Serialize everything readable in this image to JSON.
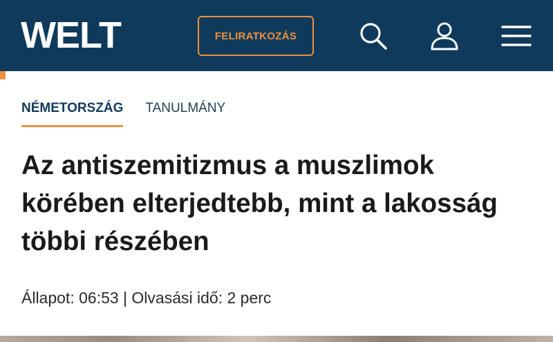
{
  "header": {
    "logo_text": "WELT",
    "subscribe_label": "FELIRATKOZÁS",
    "icons": [
      "search-icon",
      "user-icon",
      "menu-icon"
    ],
    "colors": {
      "background": "#0f3a5c",
      "accent": "#f0913c"
    }
  },
  "tabs": [
    {
      "label": "NÉMETORSZÁG",
      "active": true
    },
    {
      "label": "TANULMÁNY",
      "active": false
    }
  ],
  "article": {
    "title": "Az antiszemitizmus a muszlimok körében elterjedtebb, mint a lakosság többi részében",
    "meta": "Állapot: 06:53 | Olvasási idő: 2 perc"
  }
}
